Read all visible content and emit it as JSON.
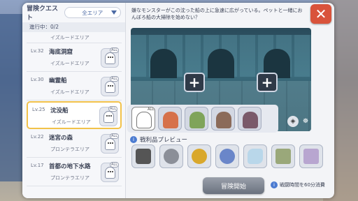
{
  "left_panel": {
    "title": "冒険クエスト",
    "area_filter": "全エリア",
    "progress": "進行中：0/2",
    "quests": [
      {
        "level": "",
        "name": "",
        "area": "イズルードエリア",
        "selected": false,
        "partial": true
      },
      {
        "level": "Lv.32",
        "name": "海底洞窟",
        "area": "イズルードエリア",
        "selected": false
      },
      {
        "level": "Lv.30",
        "name": "幽霊船",
        "area": "イズルードエリア",
        "selected": false
      },
      {
        "level": "Lv.25",
        "name": "沈没船",
        "area": "イズルードエリア",
        "selected": true
      },
      {
        "level": "Lv.22",
        "name": "迷宮の森",
        "area": "プロンテラエリア",
        "selected": false
      },
      {
        "level": "Lv.17",
        "name": "首都の地下水路",
        "area": "プロンテラエリア",
        "selected": false
      }
    ],
    "monster_tag": "ALL"
  },
  "detail": {
    "description": "嫌なモンスターがこの沈った船の上に急速に広がっている。ペットと一緒におんぼろ船の大掃除を始めない？",
    "close_icon": "close-icon",
    "party_slots": [
      "+",
      "+"
    ],
    "monster_tag": "ALL",
    "reward_title": "戦利品プレビュー",
    "start_button": "冒険開始",
    "time_note": "戦闘時間を60分消費"
  },
  "colors": {
    "accent": "#d9533b",
    "selected_border": "#f2c24a",
    "link_blue": "#4b6aa4"
  }
}
